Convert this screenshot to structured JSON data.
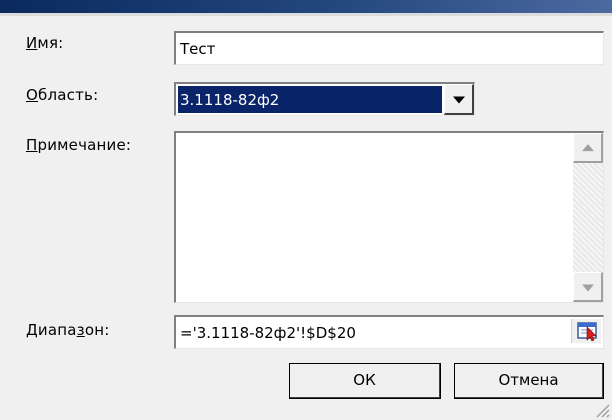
{
  "form": {
    "name": {
      "label_u": "И",
      "label_rest": "мя:",
      "value": "Тест"
    },
    "scope": {
      "label_u": "О",
      "label_rest": "бласть:",
      "value": "3.1118-82ф2"
    },
    "comment": {
      "label_u": "П",
      "label_rest": "римечание:",
      "value": ""
    },
    "range": {
      "label_pre": "Диапа",
      "label_u": "з",
      "label_rest": "он:",
      "value": "='3.1118-82ф2'!$D$20"
    }
  },
  "buttons": {
    "ok": "ОК",
    "cancel": "Отмена"
  },
  "icons": {
    "scope_dropdown": "chevron-down-icon",
    "scroll_up": "scroll-up-icon",
    "scroll_down": "scroll-down-icon",
    "range_collapse": "collapse-dialog-icon",
    "resize": "resize-grip-icon"
  },
  "colors": {
    "selection": "#0a246a",
    "dialog_bg": "#f0f0f0",
    "titlebar": "#0a2a5e"
  }
}
